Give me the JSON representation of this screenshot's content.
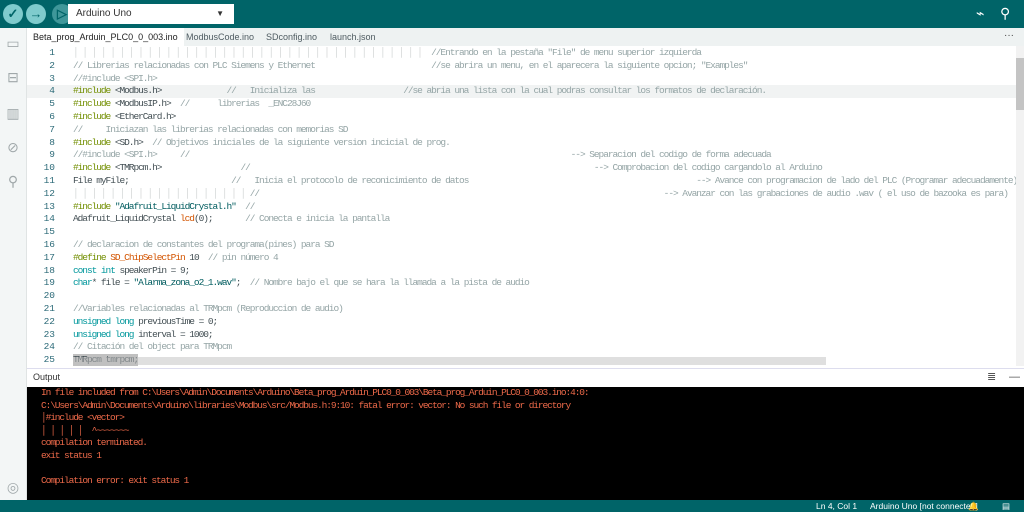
{
  "toolbar": {
    "board": "Arduino Uno",
    "verify_icon": "check-icon",
    "upload_icon": "arrow-right-icon",
    "debug_icon": "debug-icon"
  },
  "tabs": [
    "Beta_prog_Arduin_PLC0_0_003.ino",
    "ModbusCode.ino",
    "SDconfig.ino",
    "launch.json"
  ],
  "tab_more": "···",
  "code": [
    [
      [
        "g",
        "│ │ │ │ │ │ │ │ │ │ │ │ │ │ │ │ │ │ │ │ │ │ │ │ │ │ │ │ │ │ │ │ │ │ │ │ │ │  "
      ],
      [
        "c",
        "//Entrando en la pestaña \"File\" de menu superior izquierda"
      ]
    ],
    [
      [
        "c",
        "// Librerias relacionadas con PLC Siemens y Ethernet                         //se abrira un menu, en el aparecera la siguiente opcion; \"Examples\""
      ]
    ],
    [
      [
        "c",
        "//#include <SPI.h>"
      ]
    ],
    [
      [
        "p",
        "#include "
      ],
      [
        "n",
        "<Modbus.h>"
      ],
      [
        "c",
        "              //   Inicializa las                   //se abria una lista con la cual podras consultar los formatos de declaración."
      ]
    ],
    [
      [
        "p",
        "#include "
      ],
      [
        "n",
        "<ModbusIP.h>  "
      ],
      [
        "c",
        "//      librerias  _ENC28J60"
      ]
    ],
    [
      [
        "p",
        "#include "
      ],
      [
        "n",
        "<EtherCard.h>"
      ]
    ],
    [
      [
        "c",
        "//     Iniciazan las librerias relacionadas con memorias SD"
      ]
    ],
    [
      [
        "p",
        "#include "
      ],
      [
        "n",
        "<SD.h>  "
      ],
      [
        "c",
        "// Objetivos iniciales de la siguiente version incicial de prog."
      ]
    ],
    [
      [
        "c",
        "//#include <SPI.h>     //                                                                                  --> Separacion del codigo de forma adecuada"
      ]
    ],
    [
      [
        "p",
        "#include "
      ],
      [
        "n",
        "<TMRpcm.h>                 "
      ],
      [
        "c",
        "//                                                                          --> Comprobacion del codigo cargandolo al Arduino"
      ]
    ],
    [
      [
        "n",
        "File myFile;                      "
      ],
      [
        "c",
        "//   Inicia el protocolo de reconicimiento de datos                                                 --> Avance con programacion de lado del PLC (Programar adecuadamente)"
      ]
    ],
    [
      [
        "g",
        "│ │ │ │ │ │ │ │ │ │ │ │ │ │ │ │ │ │ │ "
      ],
      [
        "c",
        "//                                                                                       --> Avanzar con las grabaciones de audio .wav ( el uso de bazooka es para)"
      ]
    ],
    [
      [
        "p",
        "#include "
      ],
      [
        "s",
        "\"Adafruit_LiquidCrystal.h\"  "
      ],
      [
        "c",
        "//"
      ]
    ],
    [
      [
        "n",
        "Adafruit_LiquidCrystal "
      ],
      [
        "f",
        "lcd"
      ],
      [
        "n",
        "(0);       "
      ],
      [
        "c",
        "// Conecta e inicia la pantalla"
      ]
    ],
    [],
    [
      [
        "c",
        "// declaracion de constantes del programa(pines) para SD"
      ]
    ],
    [
      [
        "p",
        "#define "
      ],
      [
        "f",
        "SD_ChipSelectPin"
      ],
      [
        "n",
        " 10  "
      ],
      [
        "c",
        "// pin número 4"
      ]
    ],
    [
      [
        "k",
        "const int"
      ],
      [
        "n",
        " speakerPin = 9;"
      ]
    ],
    [
      [
        "k",
        "char"
      ],
      [
        "n",
        "* file = "
      ],
      [
        "s",
        "\"Alarma_zona_o2_1.wav\""
      ],
      [
        "n",
        ";  "
      ],
      [
        "c",
        "// Nombre bajo el que se hara la llamada a la pista de audio"
      ]
    ],
    [],
    [
      [
        "c",
        "//Variables relacionadas al TRMpcm (Reproduccion de audio)"
      ]
    ],
    [
      [
        "k",
        "unsigned long"
      ],
      [
        "n",
        " previousTime = 0;"
      ]
    ],
    [
      [
        "k",
        "unsigned long"
      ],
      [
        "n",
        " interval = 1000;"
      ]
    ],
    [
      [
        "c",
        "// Citación del object para TRMpcm"
      ]
    ],
    [
      [
        "n",
        "TMRpcm tmrpcm;"
      ]
    ]
  ],
  "output": {
    "title": "Output",
    "lines": [
      "In file included from C:\\Users\\Admin\\Documents\\Arduino\\Beta_prog_Arduin_PLC0_0_003\\Beta_prog_Arduin_PLC0_0_003.ino:4:0:",
      "C:\\Users\\Admin\\Documents\\Arduino\\libraries\\Modbus\\src/Modbus.h:9:10: fatal error: vector: No such file or directory",
      "│#include <vector>",
      "│ │ │ │ │  ^~~~~~~~",
      "compilation terminated.",
      "exit status 1",
      "",
      "Compilation error: exit status 1"
    ]
  },
  "status": {
    "position": "Ln 4, Col 1",
    "board": "Arduino Uno [not connected]"
  }
}
